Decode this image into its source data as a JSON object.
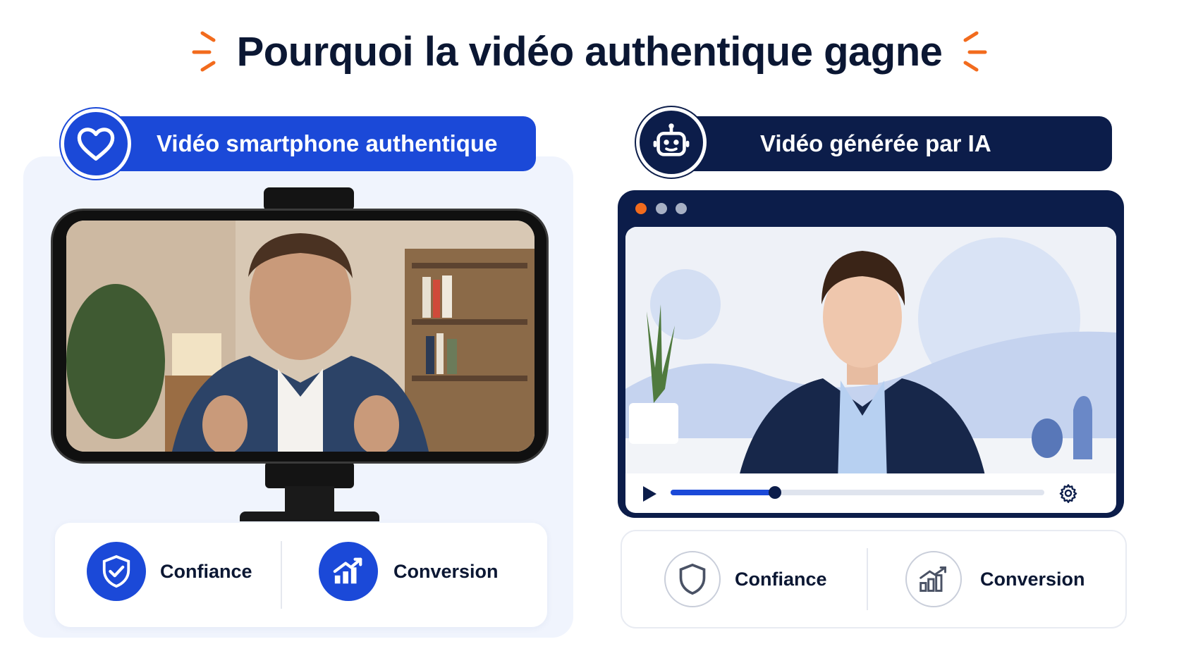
{
  "title": "Pourquoi la vidéo authentique gagne",
  "left": {
    "badge_label": "Vidéo smartphone authentique",
    "badge_icon": "heart-icon",
    "metrics": [
      {
        "label": "Confiance",
        "icon": "shield-check-icon"
      },
      {
        "label": "Conversion",
        "icon": "growth-chart-icon"
      }
    ]
  },
  "right": {
    "badge_label": "Vidéo générée par IA",
    "badge_icon": "robot-icon",
    "player": {
      "progress": 0.28
    },
    "metrics": [
      {
        "label": "Confiance",
        "icon": "shield-icon"
      },
      {
        "label": "Conversion",
        "icon": "bar-chart-icon"
      }
    ]
  },
  "colors": {
    "accent_blue": "#1b49d8",
    "navy": "#0c1d4a",
    "spark_orange": "#f26b1d"
  }
}
